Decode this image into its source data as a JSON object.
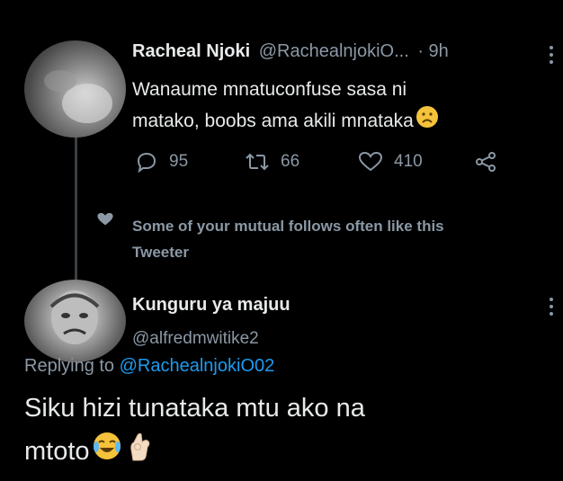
{
  "tweet": {
    "display_name": "Racheal Njoki",
    "handle": "@RachealnjokiO...",
    "time": "· 9h",
    "text_line1": "Wanaume mnatuconfuse sasa ni",
    "text_line2": "matako, boobs ama akili mnataka",
    "reply_count": "95",
    "retweet_count": "66",
    "like_count": "410"
  },
  "social_context": {
    "line1": "Some of your mutual follows often like this",
    "line2": "Tweeter"
  },
  "reply": {
    "display_name": "Kunguru ya majuu",
    "handle": "@alfredmwitike2",
    "replying_to_label": "Replying to",
    "replying_to_handle": "@RachealnjokiO02",
    "text_line1": "Siku hizi tunataka mtu ako na",
    "text_line2": "mtoto"
  },
  "colors": {
    "background": "#000000",
    "text": "#e7e9ea",
    "muted": "#8b98a5",
    "link": "#1d9bf0"
  }
}
